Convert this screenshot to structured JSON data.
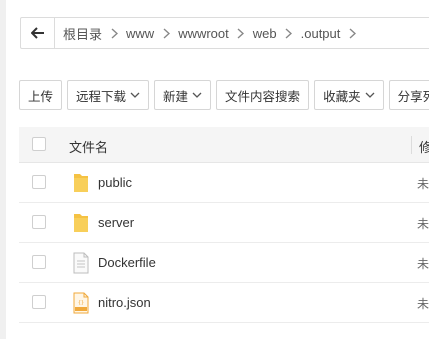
{
  "breadcrumb": {
    "items": [
      "根目录",
      "www",
      "wwwroot",
      "web",
      ".output"
    ]
  },
  "toolbar": {
    "buttons": [
      {
        "label": "上传",
        "dropdown": false
      },
      {
        "label": "远程下载",
        "dropdown": true
      },
      {
        "label": "新建",
        "dropdown": true
      },
      {
        "label": "文件内容搜索",
        "dropdown": false
      },
      {
        "label": "收藏夹",
        "dropdown": true
      },
      {
        "label": "分享列",
        "dropdown": false
      }
    ]
  },
  "table": {
    "header_name": "文件名",
    "header_next_cut": "修",
    "rows": [
      {
        "name": "public",
        "type": "folder",
        "cut": "未"
      },
      {
        "name": "server",
        "type": "folder",
        "cut": "未"
      },
      {
        "name": "Dockerfile",
        "type": "file",
        "cut": "未"
      },
      {
        "name": "nitro.json",
        "type": "json",
        "cut": "未"
      }
    ]
  },
  "colors": {
    "folder": "#f5c243",
    "json_icon": "#f0a93b",
    "border": "#dcdcdc"
  }
}
